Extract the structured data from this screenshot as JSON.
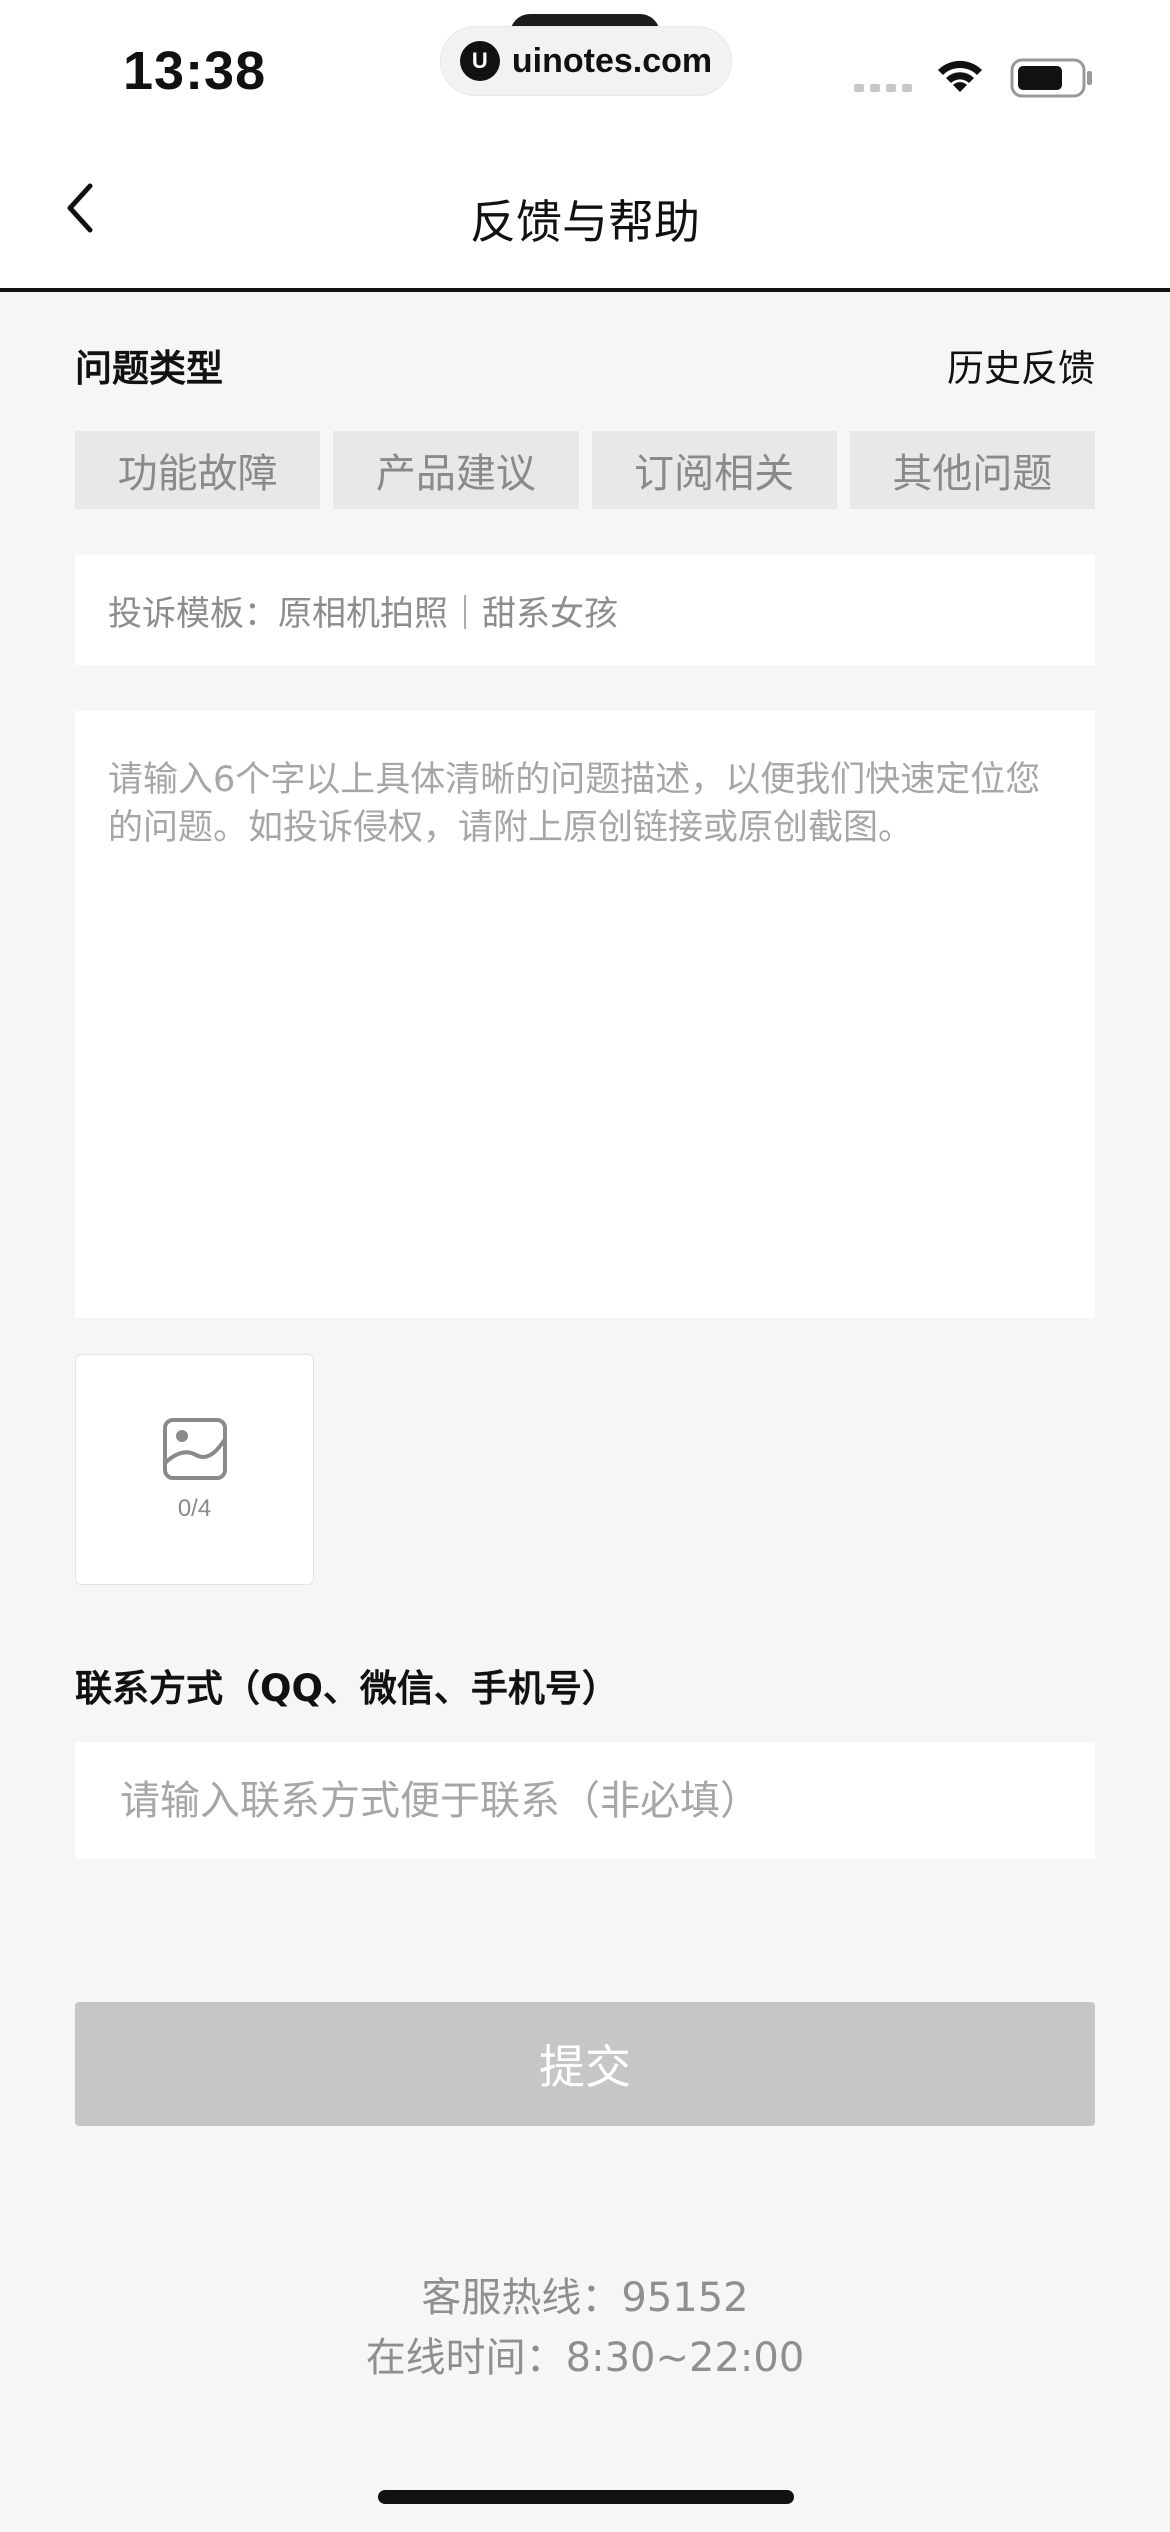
{
  "status_bar": {
    "time": "13:38",
    "url": "uinotes.com",
    "url_logo_glyph": "U",
    "icons": [
      "signal-icon",
      "wifi-icon",
      "battery-icon"
    ]
  },
  "nav": {
    "title": "反馈与帮助",
    "back_icon": "chevron-left-icon"
  },
  "issue_type": {
    "label": "问题类型",
    "history_link": "历史反馈",
    "options": [
      "功能故障",
      "产品建议",
      "订阅相关",
      "其他问题"
    ]
  },
  "complaint_template": {
    "text": "投诉模板：原相机拍照｜甜系女孩"
  },
  "description": {
    "placeholder": "请输入6个字以上具体清晰的问题描述，以便我们快速定位您的问题。如投诉侵权，请附上原创链接或原创截图。",
    "value": ""
  },
  "image_upload": {
    "icon": "image-icon",
    "count": "0/4"
  },
  "contact": {
    "label": "联系方式（QQ、微信、手机号）",
    "placeholder": "请输入联系方式便于联系（非必填）",
    "value": ""
  },
  "submit": {
    "label": "提交",
    "bg_color": "#c6c6c6"
  },
  "footer": {
    "hotline": "客服热线：95152",
    "hours": "在线时间：8:30~22:00"
  }
}
